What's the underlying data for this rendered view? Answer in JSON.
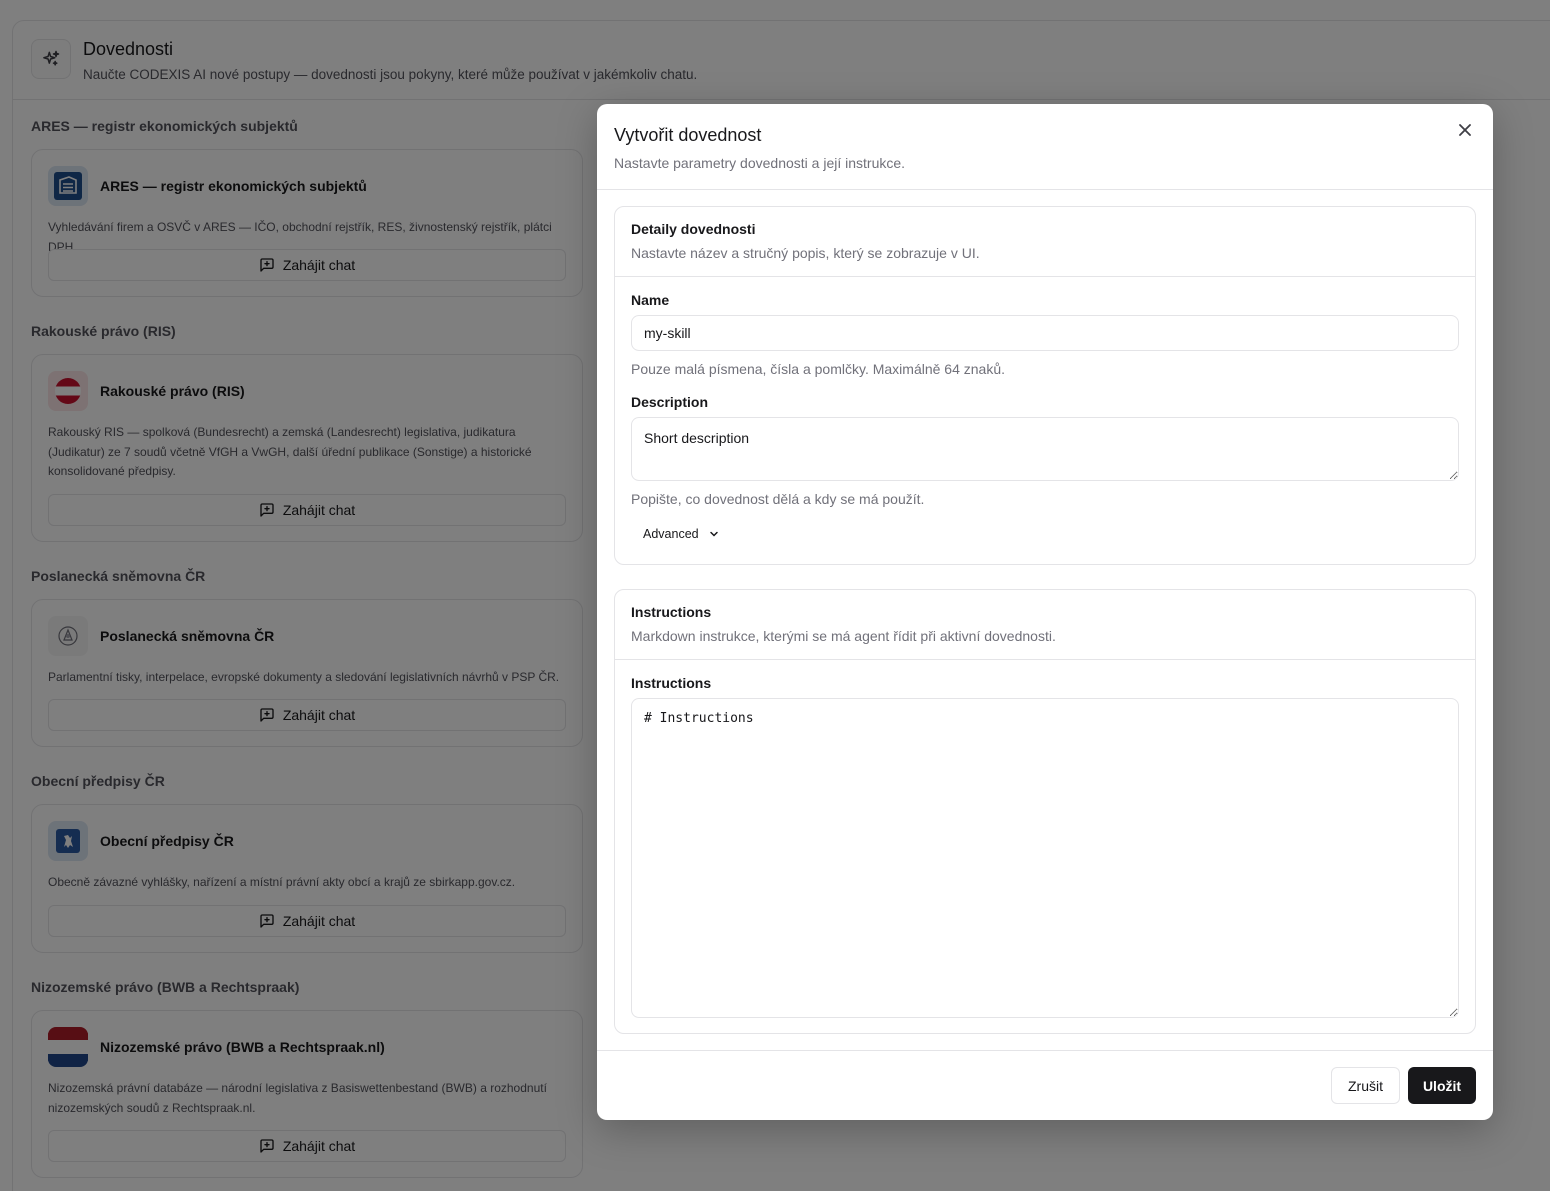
{
  "page": {
    "title": "Dovednosti",
    "subtitle": "Naučte CODEXIS AI nové postupy — dovednosti jsou pokyny, které může používat v jakémkoliv chatu."
  },
  "skills": [
    {
      "section": "ARES — registr ekonomických subjektů",
      "name": "ARES — registr ekonomických subjektů",
      "description": "Vyhledávání firem a OSVČ v ARES — IČO, obchodní rejstřík, RES, živnostenský rejstřík, plátci DPH.",
      "button": "Zahájit chat"
    },
    {
      "section": "Rakouské právo (RIS)",
      "name": "Rakouské právo (RIS)",
      "description": "Rakouský RIS — spolková (Bundesrecht) a zemská (Landesrecht) legislativa, judikatura (Judikatur) ze 7 soudů včetně VfGH a VwGH, další úřední publikace (Sonstige) a historické konsolidované předpisy.",
      "button": "Zahájit chat"
    },
    {
      "section": "Poslanecká sněmovna ČR",
      "name": "Poslanecká sněmovna ČR",
      "description": "Parlamentní tisky, interpelace, evropské dokumenty a sledování legislativních návrhů v PSP ČR.",
      "button": "Zahájit chat"
    },
    {
      "section": "Obecní předpisy ČR",
      "name": "Obecní předpisy ČR",
      "description": "Obecně závazné vyhlášky, nařízení a místní právní akty obcí a krajů ze sbirkapp.gov.cz.",
      "button": "Zahájit chat"
    },
    {
      "section": "Nizozemské právo (BWB a Rechtspraak)",
      "name": "Nizozemské právo (BWB a Rechtspraak.nl)",
      "description": "Nizozemská právní databáze — národní legislativa z Basiswettenbestand (BWB) a rozhodnutí nizozemských soudů z Rechtspraak.nl.",
      "button": "Zahájit chat"
    }
  ],
  "modal": {
    "title": "Vytvořit dovednost",
    "subtitle": "Nastavte parametry dovednosti a její instrukce.",
    "details": {
      "title": "Detaily dovednosti",
      "subtitle": "Nastavte název a stručný popis, který se zobrazuje v UI.",
      "name_label": "Name",
      "name_value": "my-skill",
      "name_hint": "Pouze malá písmena, čísla a pomlčky. Maximálně 64 znaků.",
      "desc_label": "Description",
      "desc_value": "Short description",
      "desc_hint": "Popište, co dovednost dělá a kdy se má použít.",
      "advanced_label": "Advanced"
    },
    "instructions": {
      "title": "Instructions",
      "subtitle": "Markdown instrukce, kterými se má agent řídit při aktivní dovednosti.",
      "field_label": "Instructions",
      "value": "# Instructions"
    },
    "cancel_label": "Zrušit",
    "save_label": "Uložit"
  }
}
